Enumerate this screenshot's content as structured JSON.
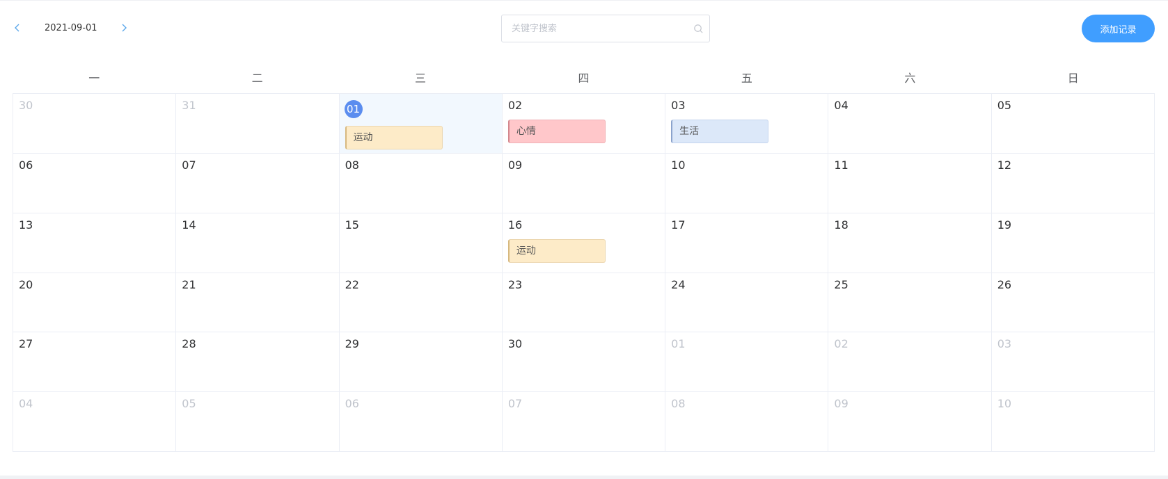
{
  "toolbar": {
    "current_date": "2021-09-01",
    "search_placeholder": "关键字搜索",
    "add_label": "添加记录",
    "prev_icon": "chevron-left-icon",
    "next_icon": "chevron-right-icon",
    "search_icon": "search-icon"
  },
  "colors": {
    "accent": "#409eff",
    "selected_day": "#5b8def",
    "tag_sport": "#fdebc8",
    "tag_mood": "#ffc7ca",
    "tag_life": "#dce8f9"
  },
  "calendar": {
    "weekdays": [
      "一",
      "二",
      "三",
      "四",
      "五",
      "六",
      "日"
    ],
    "days": [
      {
        "label": "30",
        "other": true
      },
      {
        "label": "31",
        "other": true
      },
      {
        "label": "01",
        "selected": true,
        "tag": {
          "text": "运动",
          "kind": "sport"
        }
      },
      {
        "label": "02",
        "tag": {
          "text": "心情",
          "kind": "mood"
        }
      },
      {
        "label": "03",
        "tag": {
          "text": "生活",
          "kind": "life"
        }
      },
      {
        "label": "04"
      },
      {
        "label": "05"
      },
      {
        "label": "06"
      },
      {
        "label": "07"
      },
      {
        "label": "08"
      },
      {
        "label": "09"
      },
      {
        "label": "10"
      },
      {
        "label": "11"
      },
      {
        "label": "12"
      },
      {
        "label": "13"
      },
      {
        "label": "14"
      },
      {
        "label": "15"
      },
      {
        "label": "16",
        "tag": {
          "text": "运动",
          "kind": "sport"
        }
      },
      {
        "label": "17"
      },
      {
        "label": "18"
      },
      {
        "label": "19"
      },
      {
        "label": "20"
      },
      {
        "label": "21"
      },
      {
        "label": "22"
      },
      {
        "label": "23"
      },
      {
        "label": "24"
      },
      {
        "label": "25"
      },
      {
        "label": "26"
      },
      {
        "label": "27"
      },
      {
        "label": "28"
      },
      {
        "label": "29"
      },
      {
        "label": "30"
      },
      {
        "label": "01",
        "other": true
      },
      {
        "label": "02",
        "other": true
      },
      {
        "label": "03",
        "other": true
      },
      {
        "label": "04",
        "other": true
      },
      {
        "label": "05",
        "other": true
      },
      {
        "label": "06",
        "other": true
      },
      {
        "label": "07",
        "other": true
      },
      {
        "label": "08",
        "other": true
      },
      {
        "label": "09",
        "other": true
      },
      {
        "label": "10",
        "other": true
      }
    ]
  }
}
